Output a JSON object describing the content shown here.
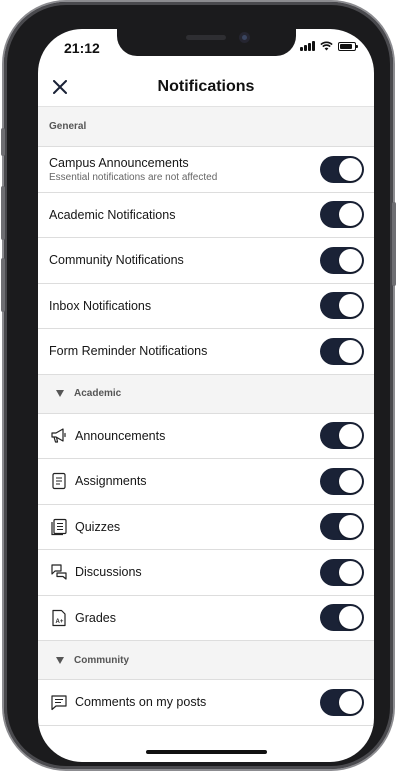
{
  "status_bar": {
    "time": "21:12"
  },
  "header": {
    "title": "Notifications"
  },
  "sections": {
    "general": {
      "label": "General",
      "items": [
        {
          "label": "Campus Announcements",
          "subtitle": "Essential notifications are not affected",
          "enabled": true
        },
        {
          "label": "Academic Notifications",
          "enabled": true
        },
        {
          "label": "Community Notifications",
          "enabled": true
        },
        {
          "label": "Inbox Notifications",
          "enabled": true
        },
        {
          "label": "Form Reminder Notifications",
          "enabled": true
        }
      ]
    },
    "academic": {
      "label": "Academic",
      "items": [
        {
          "label": "Announcements",
          "icon": "megaphone-icon",
          "enabled": true
        },
        {
          "label": "Assignments",
          "icon": "assignment-icon",
          "enabled": true
        },
        {
          "label": "Quizzes",
          "icon": "quiz-icon",
          "enabled": true
        },
        {
          "label": "Discussions",
          "icon": "discussion-icon",
          "enabled": true
        },
        {
          "label": "Grades",
          "icon": "grade-icon",
          "enabled": true
        }
      ]
    },
    "community": {
      "label": "Community",
      "items": [
        {
          "label": "Comments on my posts",
          "icon": "comment-icon",
          "enabled": true
        }
      ]
    }
  },
  "colors": {
    "toggle_on": "#1a2236",
    "section_bg": "#f4f4f4",
    "divider": "#dddddd"
  }
}
